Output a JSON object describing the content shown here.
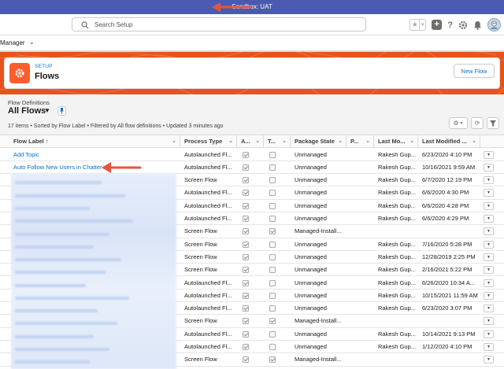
{
  "sandbox": {
    "label": "Sandbox: UAT"
  },
  "search": {
    "placeholder": "Search Setup"
  },
  "app_nav": {
    "label": "Manager"
  },
  "page_header": {
    "breadcrumb": "SETUP",
    "title": "Flows",
    "new_flow_button": "New Flow"
  },
  "list_view": {
    "object_label": "Flow Definitions",
    "view_name": "All Flows",
    "info": "17 items • Sorted by Flow Label • Filtered by All flow definitions • Updated 3 minutes ago"
  },
  "columns": [
    {
      "label": "Flow Label ↑"
    },
    {
      "label": "Process Type"
    },
    {
      "label": "A..."
    },
    {
      "label": "T..."
    },
    {
      "label": "Package State"
    },
    {
      "label": "P..."
    },
    {
      "label": "Last Mo..."
    },
    {
      "label": "Last Modified ..."
    }
  ],
  "rows": [
    {
      "label": "Add Topic",
      "process_type": "Autolaunched Fl...",
      "active": true,
      "template": false,
      "package_state": "Unmanaged",
      "modified_by": "Rakesh Gup...",
      "modified_date": "6/23/2020 4:10 PM"
    },
    {
      "label": "Auto Follow New Users in Chatter",
      "process_type": "Autolaunched Fl...",
      "active": true,
      "template": false,
      "package_state": "Unmanaged",
      "modified_by": "Rakesh Gup...",
      "modified_date": "10/16/2021 9:59 AM"
    },
    {
      "label": "",
      "process_type": "Screen Flow",
      "active": true,
      "template": false,
      "package_state": "Unmanaged",
      "modified_by": "Rakesh Gup...",
      "modified_date": "6/7/2020 12:19 PM"
    },
    {
      "label": "",
      "process_type": "Autolaunched Fl...",
      "active": true,
      "template": false,
      "package_state": "Unmanaged",
      "modified_by": "Rakesh Gup...",
      "modified_date": "6/6/2020 4:30 PM"
    },
    {
      "label": "",
      "process_type": "Autolaunched Fl...",
      "active": true,
      "template": false,
      "package_state": "Unmanaged",
      "modified_by": "Rakesh Gup...",
      "modified_date": "6/6/2020 4:28 PM"
    },
    {
      "label": "",
      "process_type": "Autolaunched Fl...",
      "active": true,
      "template": false,
      "package_state": "Unmanaged",
      "modified_by": "Rakesh Gup...",
      "modified_date": "6/6/2020 4:29 PM"
    },
    {
      "label": "",
      "process_type": "Screen Flow",
      "active": true,
      "template": true,
      "package_state": "Managed-Install...",
      "modified_by": "",
      "modified_date": ""
    },
    {
      "label": "",
      "process_type": "Screen Flow",
      "active": true,
      "template": false,
      "package_state": "Unmanaged",
      "modified_by": "Rakesh Gup...",
      "modified_date": "7/16/2020 5:28 PM"
    },
    {
      "label": "",
      "process_type": "Screen Flow",
      "active": true,
      "template": false,
      "package_state": "Unmanaged",
      "modified_by": "Rakesh Gup...",
      "modified_date": "12/28/2019 2:25 PM"
    },
    {
      "label": "",
      "process_type": "Screen Flow",
      "active": true,
      "template": false,
      "package_state": "Unmanaged",
      "modified_by": "Rakesh Gup...",
      "modified_date": "2/16/2021 5:22 PM"
    },
    {
      "label": "",
      "process_type": "Autolaunched Fl...",
      "active": true,
      "template": false,
      "package_state": "Unmanaged",
      "modified_by": "Rakesh Gup...",
      "modified_date": "6/26/2020 10:34 A..."
    },
    {
      "label": "",
      "process_type": "Autolaunched Fl...",
      "active": true,
      "template": false,
      "package_state": "Unmanaged",
      "modified_by": "Rakesh Gup...",
      "modified_date": "10/15/2021 11:59 AM"
    },
    {
      "label": "",
      "process_type": "Autolaunched Fl...",
      "active": true,
      "template": false,
      "package_state": "Unmanaged",
      "modified_by": "Rakesh Gup...",
      "modified_date": "6/23/2020 3:07 PM"
    },
    {
      "label": "",
      "process_type": "Screen Flow",
      "active": true,
      "template": true,
      "package_state": "Managed-Install...",
      "modified_by": "",
      "modified_date": ""
    },
    {
      "label": "",
      "process_type": "Autolaunched Fl...",
      "active": true,
      "template": false,
      "package_state": "Unmanaged",
      "modified_by": "Rakesh Gup...",
      "modified_date": "10/14/2021 9:13 PM"
    },
    {
      "label": "",
      "process_type": "Autolaunched Fl...",
      "active": true,
      "template": false,
      "package_state": "Unmanaged",
      "modified_by": "Rakesh Gup...",
      "modified_date": "1/12/2020 4:10 PM"
    },
    {
      "label": "",
      "process_type": "Screen Flow",
      "active": true,
      "template": true,
      "package_state": "Managed-Install...",
      "modified_by": "",
      "modified_date": ""
    }
  ],
  "icons": {
    "search": "search-icon",
    "favorite": "star-icon",
    "add": "plus-icon",
    "help": "help-icon",
    "setup": "gear-icon",
    "notifications": "bell-icon",
    "avatar": "avatar-icon",
    "flow": "flow-icon",
    "pin": "pin-icon",
    "list_settings": "gear-icon",
    "refresh": "refresh-icon",
    "filter": "filter-icon",
    "row_menu": "chevron-down-icon"
  },
  "colors": {
    "sandbox_bar": "#4b5ab1",
    "banner": "#e8531d",
    "flow_icon": "#ff5d2d",
    "link": "#0070d2",
    "callout_arrow": "#e8533f"
  }
}
